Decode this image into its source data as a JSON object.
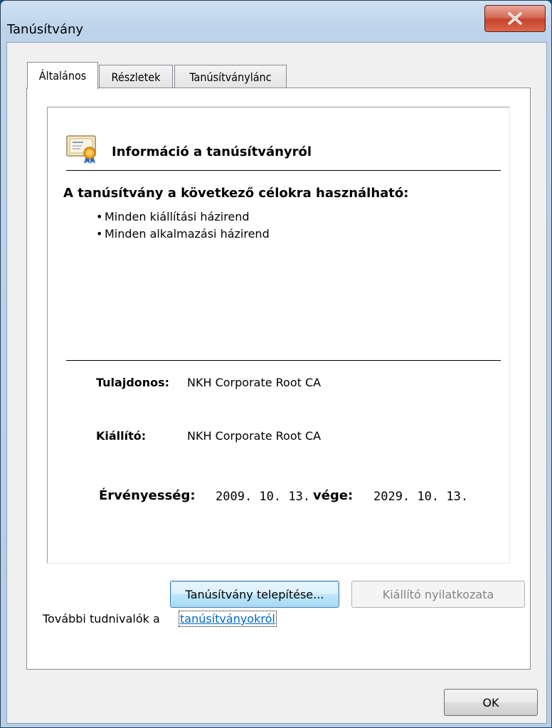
{
  "window": {
    "title": "Tanúsítvány"
  },
  "tabs": [
    {
      "label": "Általános",
      "active": true
    },
    {
      "label": "Részletek",
      "active": false
    },
    {
      "label": "Tanúsítványlánc",
      "active": false
    }
  ],
  "info": {
    "header": "Információ a tanúsítványról",
    "purpose_title": "A tanúsítvány a következő célokra használható:",
    "purposes": [
      "Minden kiállítási házirend",
      "Minden alkalmazási házirend"
    ],
    "issued_to_label": "Tulajdonos:",
    "issued_to_value": "NKH Corporate Root CA",
    "issued_by_label": "Kiállító:",
    "issued_by_value": "NKH Corporate Root CA",
    "validity_label": "Érvényesség:",
    "valid_from": "2009. 10. 13.",
    "validity_end_label": "vége:",
    "valid_to": "2029. 10. 13."
  },
  "buttons": {
    "install": "Tanúsítvány telepítése...",
    "issuer_statement": "Kiállító nyilatkozata",
    "ok": "OK"
  },
  "more_info": {
    "text": "További tudnivalók a",
    "link": "tanúsítványokról"
  },
  "icons": {
    "close": "close-x-icon",
    "certificate": "certificate-icon"
  },
  "colors": {
    "close_button": "#c7422a",
    "link": "#0066cc",
    "focused_button_border": "#3c7fb1"
  }
}
